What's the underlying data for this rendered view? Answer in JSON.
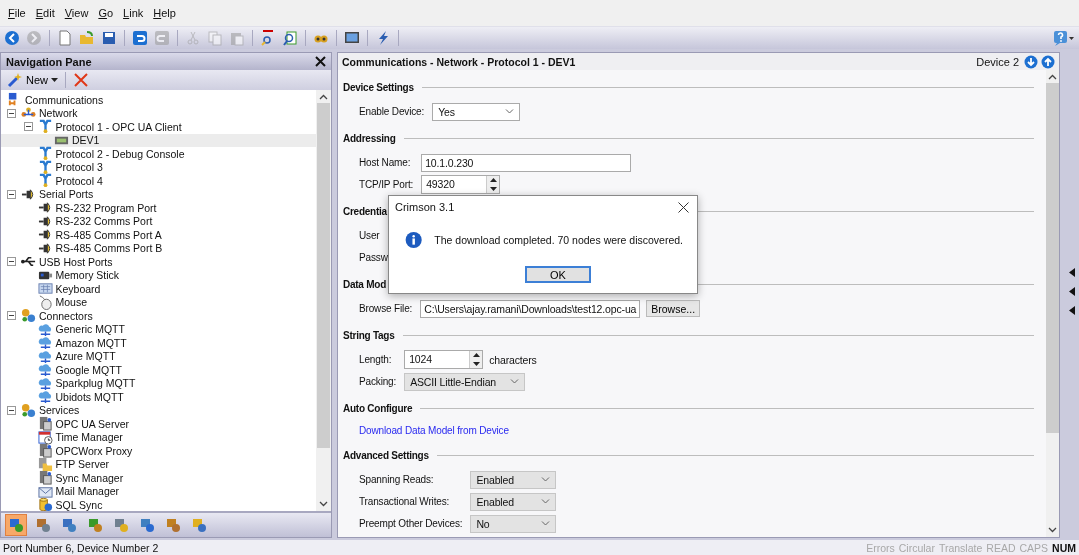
{
  "menu": [
    {
      "label": "File"
    },
    {
      "label": "Edit"
    },
    {
      "label": "View"
    },
    {
      "label": "Go"
    },
    {
      "label": "Link"
    },
    {
      "label": "Help"
    }
  ],
  "toolbar": [
    {
      "disabled": false
    },
    {
      "disabled": true
    },
    {
      "disabled": false
    },
    {
      "disabled": false
    },
    {
      "disabled": false
    },
    {
      "disabled": false
    },
    {
      "disabled": true
    },
    {
      "disabled": true
    },
    {
      "disabled": true
    },
    {
      "disabled": true
    },
    {
      "disabled": false
    },
    {
      "disabled": false
    },
    {
      "disabled": false
    },
    {
      "disabled": false
    },
    {
      "disabled": false
    }
  ],
  "navigation_pane": {
    "title": "Navigation Pane",
    "new_button": "New",
    "tree": [
      {
        "label": "Communications",
        "kind": "root",
        "selected": false
      },
      {
        "label": "Network",
        "kind": "network",
        "selected": false,
        "expanded": true,
        "children": [
          {
            "label": "Protocol 1 - OPC UA Client",
            "kind": "protocol",
            "selected": false,
            "expanded": true,
            "children": [
              {
                "label": "DEV1",
                "kind": "device",
                "selected": true
              }
            ]
          },
          {
            "label": "Protocol 2 - Debug Console",
            "kind": "protocol",
            "selected": false
          },
          {
            "label": "Protocol 3",
            "kind": "protocol",
            "selected": false
          },
          {
            "label": "Protocol 4",
            "kind": "protocol",
            "selected": false
          }
        ]
      },
      {
        "label": "Serial Ports",
        "kind": "port",
        "selected": false,
        "expanded": true,
        "children": [
          {
            "label": "RS-232 Program Port",
            "kind": "port",
            "selected": false
          },
          {
            "label": "RS-232 Comms Port",
            "kind": "port",
            "selected": false
          },
          {
            "label": "RS-485 Comms Port A",
            "kind": "port",
            "selected": false
          },
          {
            "label": "RS-485 Comms Port B",
            "kind": "port",
            "selected": false
          }
        ]
      },
      {
        "label": "USB Host Ports",
        "kind": "usb",
        "selected": false,
        "expanded": true,
        "children": [
          {
            "label": "Memory Stick",
            "kind": "memory",
            "selected": false
          },
          {
            "label": "Keyboard",
            "kind": "keyboard",
            "selected": false
          },
          {
            "label": "Mouse",
            "kind": "mouse",
            "selected": false
          }
        ]
      },
      {
        "label": "Connectors",
        "kind": "gears",
        "selected": false,
        "expanded": true,
        "children": [
          {
            "label": "Generic MQTT",
            "kind": "cloud",
            "selected": false
          },
          {
            "label": "Amazon MQTT",
            "kind": "cloud",
            "selected": false
          },
          {
            "label": "Azure MQTT",
            "kind": "cloud",
            "selected": false
          },
          {
            "label": "Google MQTT",
            "kind": "cloud",
            "selected": false
          },
          {
            "label": "Sparkplug MQTT",
            "kind": "cloud",
            "selected": false
          },
          {
            "label": "Ubidots MQTT",
            "kind": "cloud",
            "selected": false
          }
        ]
      },
      {
        "label": "Services",
        "kind": "gears",
        "selected": false,
        "expanded": true,
        "children": [
          {
            "label": "OPC UA Server",
            "kind": "server",
            "selected": false
          },
          {
            "label": "Time Manager",
            "kind": "calendar",
            "selected": false
          },
          {
            "label": "OPCWorx Proxy",
            "kind": "server",
            "selected": false
          },
          {
            "label": "FTP Server",
            "kind": "folder",
            "selected": false
          },
          {
            "label": "Sync Manager",
            "kind": "server",
            "selected": false
          },
          {
            "label": "Mail Manager",
            "kind": "mail",
            "selected": false
          },
          {
            "label": "SQL Sync",
            "kind": "database",
            "selected": false
          }
        ]
      }
    ],
    "categories": [
      {
        "selected": true
      },
      {
        "selected": false
      },
      {
        "selected": false
      },
      {
        "selected": false
      },
      {
        "selected": false
      },
      {
        "selected": false
      },
      {
        "selected": false
      },
      {
        "selected": false
      }
    ]
  },
  "editor": {
    "title": "Communications - Network - Protocol 1 - DEV1",
    "device": "Device 2",
    "sections": [
      {
        "title": "Device Settings",
        "fields": [
          {
            "kind": "dropdown",
            "label": "Enable Device:",
            "value": "Yes"
          }
        ]
      },
      {
        "title": "Addressing",
        "fields": [
          {
            "kind": "text",
            "label": "Host Name:",
            "value": "10.1.0.230"
          },
          {
            "kind": "spin",
            "label": "TCP/IP Port:",
            "value": "49320"
          }
        ]
      },
      {
        "title": "Credentia",
        "fields": [
          {
            "kind": "label",
            "label": "User"
          },
          {
            "kind": "label",
            "label": "Passw"
          }
        ]
      },
      {
        "title": "Data Mod",
        "fields": [
          {
            "kind": "file",
            "label": "Browse File:",
            "value": "C:\\Users\\ajay.ramani\\Downloads\\test12.opc-ua",
            "button": "Browse..."
          }
        ]
      },
      {
        "title": "String Tags",
        "fields": [
          {
            "kind": "spin",
            "label": "Length:",
            "value": "1024",
            "unit": "characters"
          },
          {
            "kind": "combo",
            "label": "Packing:",
            "value": "ASCII Little-Endian"
          }
        ]
      },
      {
        "title": "Auto Configure",
        "fields": [
          {
            "kind": "link",
            "label": "Download Data Model from Device"
          }
        ]
      },
      {
        "title": "Advanced Settings",
        "fields": [
          {
            "kind": "combo",
            "label": "Spanning Reads:",
            "value": "Enabled"
          },
          {
            "kind": "combo",
            "label": "Transactional Writes:",
            "value": "Enabled"
          },
          {
            "kind": "combo",
            "label": "Preempt Other Devices:",
            "value": "No"
          }
        ]
      }
    ]
  },
  "dialog": {
    "title": "Crimson 3.1",
    "message": "The download completed. 70 nodes were discovered.",
    "button": "OK"
  },
  "status_bar": {
    "text": "Port Number 6, Device Number 2",
    "indicators": [
      {
        "label": "Errors",
        "on": false
      },
      {
        "label": "Circular",
        "on": false
      },
      {
        "label": "Translate",
        "on": false
      },
      {
        "label": "READ",
        "on": false
      },
      {
        "label": "CAPS",
        "on": false
      },
      {
        "label": "NUM",
        "on": true
      }
    ]
  }
}
